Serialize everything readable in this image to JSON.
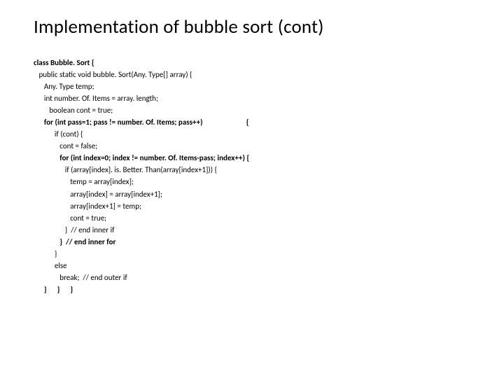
{
  "title": "Implementation of bubble sort (cont)",
  "code": [
    {
      "text": "class Bubble. Sort {",
      "indent": 0,
      "bold": true
    },
    {
      "text": "public static void bubble. Sort(Any. Type[] array) {",
      "indent": 1,
      "bold": false
    },
    {
      "text": "Any. Type temp;",
      "indent": 2,
      "bold": false
    },
    {
      "text": "int number. Of. Items = array. length;",
      "indent": 2,
      "bold": false
    },
    {
      "text": "boolean cont = true;",
      "indent": 3,
      "bold": false
    },
    {
      "text": "for (int pass=1; pass != number. Of. Items; pass++)                         {",
      "indent": 2,
      "bold": true
    },
    {
      "text": "if (cont) {",
      "indent": 4,
      "bold": false
    },
    {
      "text": "cont = false;",
      "indent": 5,
      "bold": false
    },
    {
      "text": "for (int index=0; index != number. Of. Items-pass; index++) {",
      "indent": 5,
      "bold": true
    },
    {
      "text": "if (array[index]. is. Better. Than(array[index+1])) {",
      "indent": 6,
      "bold": false
    },
    {
      "text": "temp = array[index];",
      "indent": 7,
      "bold": false
    },
    {
      "text": "array[index] = array[index+1];",
      "indent": 7,
      "bold": false
    },
    {
      "text": "array[index+1] = temp;",
      "indent": 7,
      "bold": false
    },
    {
      "text": "cont = true;",
      "indent": 7,
      "bold": false
    },
    {
      "text": "}  // end inner if",
      "indent": 6,
      "bold": false
    },
    {
      "text": "}  // end inner for",
      "indent": 5,
      "bold": true
    },
    {
      "text": "}",
      "indent": 4,
      "bold": false
    },
    {
      "text": "else",
      "indent": 4,
      "bold": false
    },
    {
      "text": "break;  // end outer if",
      "indent": 5,
      "bold": false
    },
    {
      "text": "}      }      }",
      "indent": 2,
      "bold": true
    }
  ],
  "indentUnit": "   "
}
